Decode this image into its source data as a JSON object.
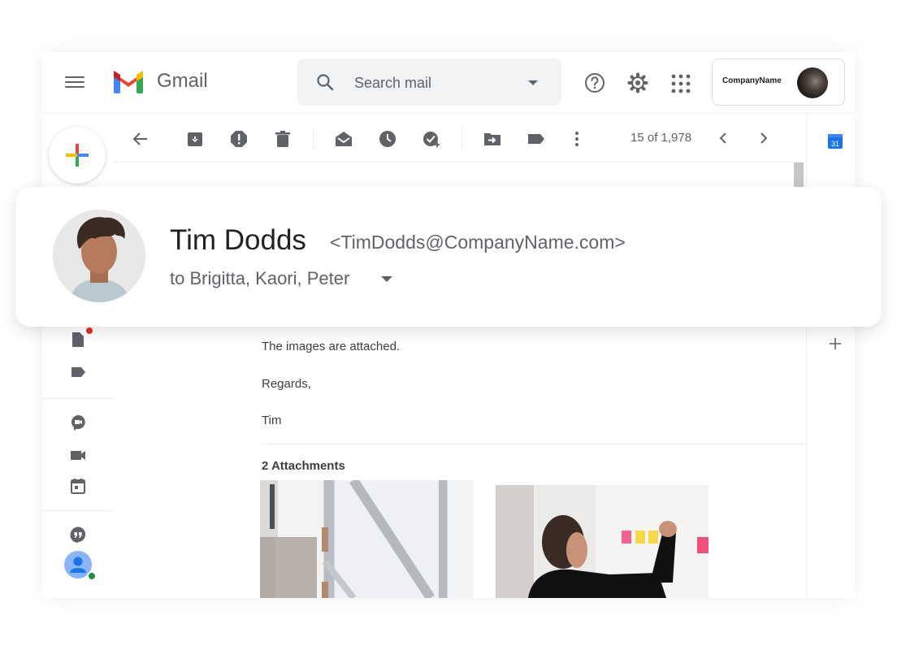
{
  "app": {
    "name": "Gmail",
    "brand_colors": {
      "red": "#EA4335",
      "blue": "#4285F4",
      "yellow": "#FBBC04",
      "green": "#34A853"
    }
  },
  "search": {
    "placeholder": "Search mail",
    "value": ""
  },
  "account": {
    "name": "CompanyName"
  },
  "toolbar": {
    "actions": [
      {
        "icon": "back-arrow-icon",
        "label": "Back"
      },
      {
        "icon": "archive-icon",
        "label": "Archive"
      },
      {
        "icon": "report-spam-icon",
        "label": "Report spam"
      },
      {
        "icon": "delete-icon",
        "label": "Delete"
      },
      {
        "icon": "mark-unread-icon",
        "label": "Mark as unread"
      },
      {
        "icon": "snooze-icon",
        "label": "Snooze"
      },
      {
        "icon": "add-task-icon",
        "label": "Add to Tasks"
      },
      {
        "icon": "move-to-icon",
        "label": "Move to"
      },
      {
        "icon": "label-icon",
        "label": "Labels"
      },
      {
        "icon": "more-icon",
        "label": "More"
      }
    ],
    "pager_text": "15 of 1,978"
  },
  "email": {
    "sender_name": "Tim Dodds",
    "sender_email": "<TimDodds@CompanyName.com>",
    "recipients": "to Brigitta, Kaori, Peter",
    "body_lines": [
      "The images are attached.",
      "Regards,",
      "Tim"
    ],
    "attachments_title": "2 Attachments",
    "attachments": [
      {
        "description": "office-window-photo"
      },
      {
        "description": "man-with-sticky-notes-photo"
      }
    ]
  },
  "right_rail": {
    "calendar_day": "31"
  },
  "left_rail": {
    "items": [
      "drafts-icon",
      "label-icon",
      "meet-icon",
      "video-icon",
      "calendar-icon",
      "hangouts-icon",
      "user-avatar"
    ],
    "notification_color": "#d93025",
    "presence_color": "#1e8e3e"
  }
}
